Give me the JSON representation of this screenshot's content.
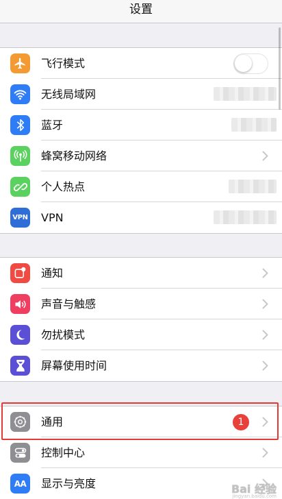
{
  "nav": {
    "title": "设置"
  },
  "groups": [
    {
      "items": [
        {
          "label": "飞行模式",
          "icon": "airplane-icon",
          "color": "#f49a32",
          "accessory": "toggle",
          "toggle_on": false
        },
        {
          "label": "无线局域网",
          "icon": "wifi-icon",
          "color": "#2f7df6",
          "accessory": "blurred-value"
        },
        {
          "label": "蓝牙",
          "icon": "bluetooth-icon",
          "color": "#2f7df6",
          "accessory": "blurred-value"
        },
        {
          "label": "蜂窝移动网络",
          "icon": "cellular-icon",
          "color": "#5bd15f",
          "accessory": "chevron"
        },
        {
          "label": "个人热点",
          "icon": "hotspot-icon",
          "color": "#5bd15f",
          "accessory": "blurred-value"
        },
        {
          "label": "VPN",
          "icon": "vpn-icon",
          "icon_text": "VPN",
          "color": "#2f6ed6",
          "accessory": "blurred-value"
        }
      ]
    },
    {
      "items": [
        {
          "label": "通知",
          "icon": "notifications-icon",
          "color": "#ef4b43",
          "accessory": "chevron"
        },
        {
          "label": "声音与触感",
          "icon": "sound-icon",
          "color": "#ef3e5f",
          "accessory": "chevron"
        },
        {
          "label": "勿扰模式",
          "icon": "moon-icon",
          "color": "#5b4fd6",
          "accessory": "chevron"
        },
        {
          "label": "屏幕使用时间",
          "icon": "hourglass-icon",
          "color": "#5b4fd6",
          "accessory": "chevron"
        }
      ]
    },
    {
      "items": [
        {
          "label": "通用",
          "icon": "gear-icon",
          "color": "#8e8e93",
          "accessory": "chevron",
          "badge": "1",
          "highlighted": true
        },
        {
          "label": "控制中心",
          "icon": "control-center-icon",
          "color": "#8e8e93",
          "accessory": "chevron"
        },
        {
          "label": "显示与亮度",
          "icon": "display-brightness-icon",
          "icon_text": "AA",
          "color": "#2f7df6",
          "accessory": "chevron"
        }
      ]
    }
  ],
  "watermark": {
    "text": "Bai 经验",
    "sub": "jingyan.baidu.com"
  },
  "colors": {
    "background": "#efeff4",
    "highlight_border": "#e53935",
    "badge": "#e8403b"
  }
}
